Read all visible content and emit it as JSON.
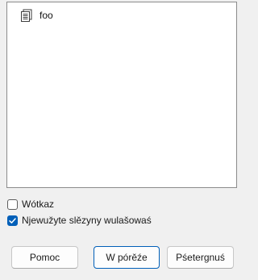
{
  "tree": {
    "items": [
      {
        "label": "foo",
        "icon": "text-file-icon"
      }
    ]
  },
  "options": {
    "wotkaz": {
      "label": "Wótkaz",
      "checked": false
    },
    "unused_styles": {
      "label": "Njewužyte slězyny wulašowaś",
      "checked": true
    }
  },
  "buttons": {
    "help": "Pomoc",
    "ok": "W pórěźe",
    "cancel": "Pśetergnuś"
  },
  "colors": {
    "accent": "#005fb8"
  }
}
